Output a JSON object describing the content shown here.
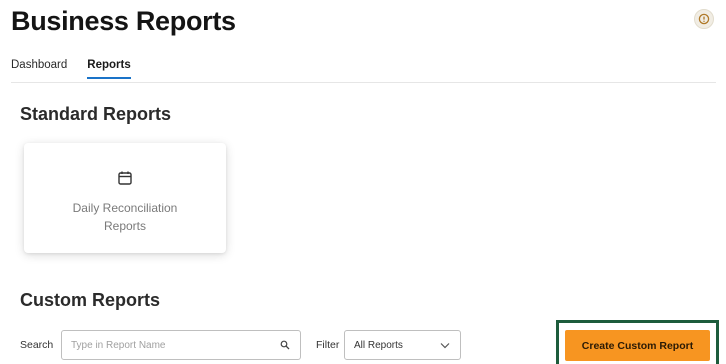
{
  "header": {
    "title": "Business Reports",
    "help_icon": "help-circle-icon"
  },
  "tabs": [
    {
      "label": "Dashboard",
      "active": false
    },
    {
      "label": "Reports",
      "active": true
    }
  ],
  "standard_reports": {
    "title": "Standard Reports",
    "cards": [
      {
        "icon": "calendar-icon",
        "label": "Daily Reconciliation Reports"
      }
    ]
  },
  "custom_reports": {
    "title": "Custom Reports",
    "search": {
      "label": "Search",
      "placeholder": "Type in Report Name",
      "value": "",
      "icon": "search-icon"
    },
    "filter": {
      "label": "Filter",
      "selected": "All Reports",
      "icon": "chevron-down-icon"
    },
    "create_button": {
      "label": "Create Custom Report"
    }
  },
  "colors": {
    "accent": "#f79521",
    "tab_underline": "#1a73c8",
    "highlight_frame": "#1d5c3c"
  }
}
